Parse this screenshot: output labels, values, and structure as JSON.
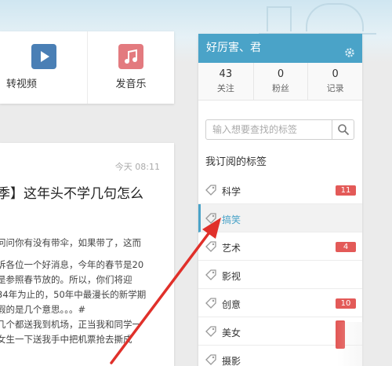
{
  "publish": {
    "items": [
      {
        "label": "转视频",
        "icon": "video-play-icon"
      },
      {
        "label": "发音乐",
        "icon": "music-note-icon"
      }
    ]
  },
  "post": {
    "time": "今天 08:11",
    "title": "季】这年头不学几句怎么",
    "paragraphs": [
      "问问你有没有带伞，如果带了，这而",
      "诉各位一个好消息，今年的春节是20",
      "是参照春节放的。所以，你们将迎",
      "34年为止的，50年中最漫长的新学期",
      "假的是几个意思。。。#",
      "几个都送我到机场，正当我和同学一",
      "女生一下送我手中把机票抢去撕成"
    ]
  },
  "user": {
    "name": "好厉害、君",
    "stats": [
      {
        "value": "43",
        "label": "关注"
      },
      {
        "value": "0",
        "label": "粉丝"
      },
      {
        "value": "0",
        "label": "记录"
      }
    ]
  },
  "search": {
    "placeholder": "输入想要查找的标签"
  },
  "tags": {
    "heading": "我订阅的标签",
    "items": [
      {
        "label": "科学",
        "count": "11"
      },
      {
        "label": "搞笑",
        "count": ""
      },
      {
        "label": "艺术",
        "count": "4"
      },
      {
        "label": "影视",
        "count": ""
      },
      {
        "label": "创意",
        "count": "10"
      },
      {
        "label": "美女",
        "count": ""
      },
      {
        "label": "摄影",
        "count": ""
      }
    ]
  },
  "colors": {
    "accent": "#4aa3c8",
    "badge": "#e35a58",
    "arrow": "#e0302a"
  }
}
